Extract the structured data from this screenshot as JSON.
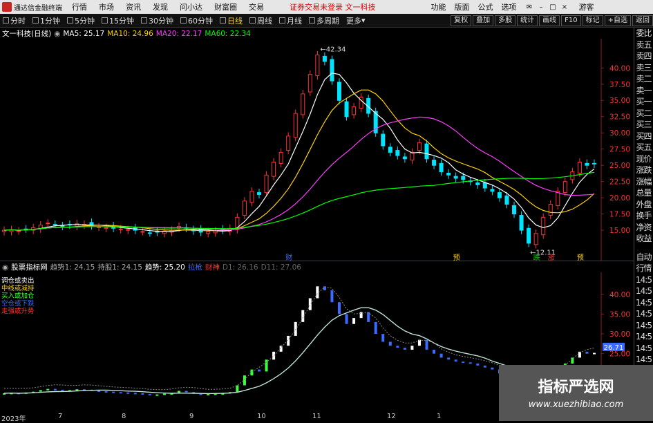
{
  "menubar": {
    "app_title": "通达信金融终端",
    "items": [
      "行情",
      "市场",
      "资讯",
      "发现",
      "问小达",
      "财富圈",
      "交易"
    ],
    "notice": "证券交易未登录",
    "stock_name": "文一科技",
    "right_items": [
      "功能",
      "版面",
      "公式",
      "选项"
    ],
    "login": "游客"
  },
  "toolbar": {
    "periods": [
      "分时",
      "1分钟",
      "5分钟",
      "15分钟",
      "30分钟",
      "60分钟",
      "日线",
      "周线",
      "月线",
      "多周期",
      "更多"
    ],
    "active_period": "日线",
    "right_buttons": [
      "复权",
      "叠加",
      "多股",
      "统计",
      "画线",
      "F10",
      "标记",
      "+自选",
      "返回"
    ]
  },
  "main_legend": {
    "title": "文一科技(日线)",
    "ma5": "MA5: 25.17",
    "ma10": "MA10: 24.96",
    "ma20": "MA20: 22.17",
    "ma60": "MA60: 22.34"
  },
  "sub_legend": {
    "title": "股票指标网",
    "items": [
      "趋势1: 24.15",
      "持股1: 24.15",
      "趋势: 25.20",
      "拉枪",
      "财神",
      "D1: 26.16",
      "D11: 27.06"
    ]
  },
  "signals": [
    "调仓或卖出",
    "中线或减持",
    "买入或加仓",
    "空仓或下跌",
    "走强或升势"
  ],
  "price_labels": {
    "high": "42.34",
    "low": "12.11"
  },
  "markers": [
    "财",
    "预",
    "跌",
    "涨",
    "预"
  ],
  "sidebar": [
    "委比",
    "卖五",
    "卖四",
    "卖三",
    "卖二",
    "卖一",
    "买一",
    "买二",
    "买三",
    "买四",
    "买五",
    "现价",
    "涨跌",
    "涨幅",
    "总量",
    "外盘",
    "换手",
    "净资",
    "收益",
    "",
    "自动",
    "行情",
    "14:5",
    "14:5",
    "14:5",
    "14:5",
    "14:5",
    "14:5",
    "14:5",
    "14:5",
    "14:5"
  ],
  "date_axis": [
    "2023年",
    "7",
    "8",
    "9",
    "10",
    "11",
    "12",
    "1"
  ],
  "watermark": {
    "title": "指标严选网",
    "url": "www.xuezhibiao.com"
  },
  "chart_data": [
    {
      "type": "candlestick",
      "title": "文一科技(日线)",
      "ylim": [
        11.5,
        44.5
      ],
      "yticks": [
        15.0,
        17.5,
        20.0,
        22.5,
        25.0,
        27.5,
        30.0,
        32.5,
        35.0,
        37.5,
        40.0
      ],
      "close": [
        15.0,
        15.1,
        14.9,
        15.2,
        15.4,
        15.8,
        16.1,
        15.9,
        15.6,
        15.8,
        16.0,
        15.9,
        15.7,
        15.5,
        15.4,
        15.3,
        15.2,
        15.1,
        15.0,
        14.8,
        14.6,
        14.7,
        14.9,
        15.0,
        15.6,
        15.3,
        14.9,
        14.7,
        14.8,
        14.9,
        15.0,
        15.3,
        17.0,
        19.5,
        21.0,
        20.5,
        23.5,
        25.5,
        27.0,
        29.5,
        33.0,
        36.0,
        39.0,
        42.0,
        41.0,
        38.0,
        35.0,
        32.5,
        34.0,
        35.5,
        33.0,
        30.0,
        28.0,
        27.0,
        26.5,
        26.0,
        27.0,
        28.5,
        26.0,
        25.0,
        24.0,
        23.5,
        23.0,
        22.8,
        22.5,
        22.0,
        21.5,
        21.0,
        20.0,
        19.0,
        17.5,
        15.0,
        13.0,
        14.5,
        17.0,
        19.0,
        21.0,
        22.5,
        24.0,
        25.5,
        25.0,
        25.2
      ]
    },
    {
      "type": "line",
      "title": "股票指标网",
      "ylim": [
        11.5,
        44.5
      ],
      "yticks": [
        15.0,
        20.0,
        25.0,
        30.0,
        35.0,
        40.0
      ],
      "series": [
        {
          "name": "趋势",
          "values": []
        }
      ],
      "current_value_label": "26.71"
    }
  ],
  "colors": {
    "up": "#ff3232",
    "down": "#00e5ff",
    "ma5": "#ffffff",
    "ma10": "#ffd200",
    "ma20": "#ff3cff",
    "ma60": "#00ff00",
    "panel_border": "#8a1f1f"
  }
}
